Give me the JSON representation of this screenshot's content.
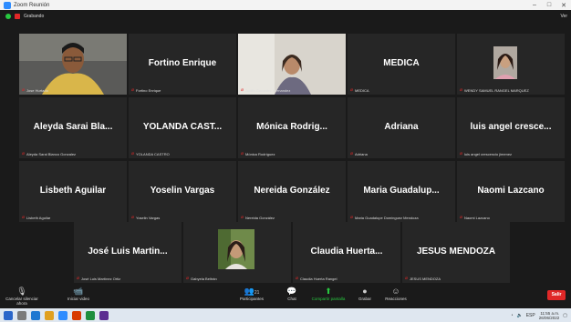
{
  "window": {
    "title": "Zoom Reunión",
    "controls": [
      "–",
      "□",
      "✕"
    ]
  },
  "toolbar": {
    "meeting_label": "Grabando",
    "view_label": "Ver"
  },
  "tiles": [
    {
      "name": "",
      "caption": "Jose Hurtado",
      "video": "man-glasses"
    },
    {
      "name": "Fortino Enrique",
      "caption": "Fortino Enrique"
    },
    {
      "name": "",
      "caption": "Judith Gonzalez Hernandez",
      "video": "woman-white-wall",
      "active": true
    },
    {
      "name": "MEDICA",
      "caption": "MEDICA"
    },
    {
      "name": "",
      "caption": "WENDY SAMUEL RANGEL MARQUEZ",
      "video": "woman-avatar"
    },
    {
      "name": "Aleyda Sarai Bla...",
      "caption": "Aleyda Sarai Blanco Gonzalez"
    },
    {
      "name": "YOLANDA CAST...",
      "caption": "YOLANDA CASTRO"
    },
    {
      "name": "Mónica Rodrig...",
      "caption": "Mónica Rodríguez"
    },
    {
      "name": "Adriana",
      "caption": "Adriana"
    },
    {
      "name": "luis angel cresce...",
      "caption": "luis angel crescencio jimenez"
    },
    {
      "name": "Lisbeth Aguilar",
      "caption": "Lisbeth Aguilar"
    },
    {
      "name": "Yoselin Vargas",
      "caption": "Yoselin Vargas"
    },
    {
      "name": "Nereida González",
      "caption": "Nereida González"
    },
    {
      "name": "Maria Guadalup...",
      "caption": "Maria Guadalupe Dominguez Mendoza"
    },
    {
      "name": "Naomi Lazcano",
      "caption": "Naomi Lazcano"
    },
    {
      "name": "José Luis Martin...",
      "caption": "José Luis Martínez Ortiz"
    },
    {
      "name": "",
      "caption": "Gabyela Beltrán",
      "video": "woman-plant"
    },
    {
      "name": "Claudia Huerta...",
      "caption": "Claudia Huerta Rangel"
    },
    {
      "name": "JESUS MENDOZA",
      "caption": "JESUS MENDOZA"
    }
  ],
  "controls": {
    "mute": "Cancelar silenciar ahora",
    "video": "Iniciar video",
    "participants": "Participantes",
    "participants_count": "21",
    "chat": "Chat",
    "share": "Compartir pantalla",
    "record": "Grabar",
    "reactions": "Reacciones",
    "leave": "Salir"
  },
  "taskbar": {
    "time": "11:55 a.m.",
    "date": "26/06/2022",
    "lang": "ESP"
  },
  "colors": {
    "accent": "#28c840",
    "active_border": "#8fd14f",
    "danger": "#e02828",
    "tile_bg": "#262626"
  }
}
